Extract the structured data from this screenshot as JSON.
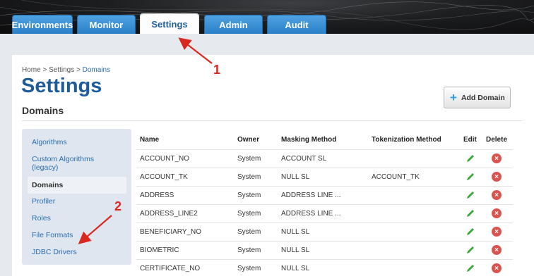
{
  "nav": {
    "tabs": [
      {
        "label": "Environments"
      },
      {
        "label": "Monitor"
      },
      {
        "label": "Settings"
      },
      {
        "label": "Admin"
      },
      {
        "label": "Audit"
      }
    ]
  },
  "breadcrumb": {
    "home": "Home",
    "sep": ">",
    "settings": "Settings",
    "current": "Domains"
  },
  "page": {
    "title": "Settings",
    "section": "Domains",
    "add_button": "Add Domain"
  },
  "sidebar": {
    "items": [
      {
        "label": "Algorithms"
      },
      {
        "label": "Custom Algorithms (legacy)"
      },
      {
        "label": "Domains"
      },
      {
        "label": "Profiler"
      },
      {
        "label": "Roles"
      },
      {
        "label": "File Formats"
      },
      {
        "label": "JDBC Drivers"
      }
    ]
  },
  "table": {
    "headers": [
      "Name",
      "Owner",
      "Masking Method",
      "Tokenization Method",
      "Edit",
      "Delete"
    ],
    "rows": [
      {
        "name": "ACCOUNT_NO",
        "owner": "System",
        "masking": "ACCOUNT SL",
        "tokenization": ""
      },
      {
        "name": "ACCOUNT_TK",
        "owner": "System",
        "masking": "NULL SL",
        "tokenization": "ACCOUNT_TK"
      },
      {
        "name": "ADDRESS",
        "owner": "System",
        "masking": "ADDRESS LINE ...",
        "tokenization": ""
      },
      {
        "name": "ADDRESS_LINE2",
        "owner": "System",
        "masking": "ADDRESS LINE ...",
        "tokenization": ""
      },
      {
        "name": "BENEFICIARY_NO",
        "owner": "System",
        "masking": "NULL SL",
        "tokenization": ""
      },
      {
        "name": "BIOMETRIC",
        "owner": "System",
        "masking": "NULL SL",
        "tokenization": ""
      },
      {
        "name": "CERTIFICATE_NO",
        "owner": "System",
        "masking": "NULL SL",
        "tokenization": ""
      }
    ]
  },
  "callouts": {
    "one": "1",
    "two": "2"
  },
  "colors": {
    "accent": "#2a7fc7",
    "title": "#1e5c99",
    "callout": "#d9281f",
    "edit": "#3aa83a",
    "delete": "#d9534f"
  }
}
